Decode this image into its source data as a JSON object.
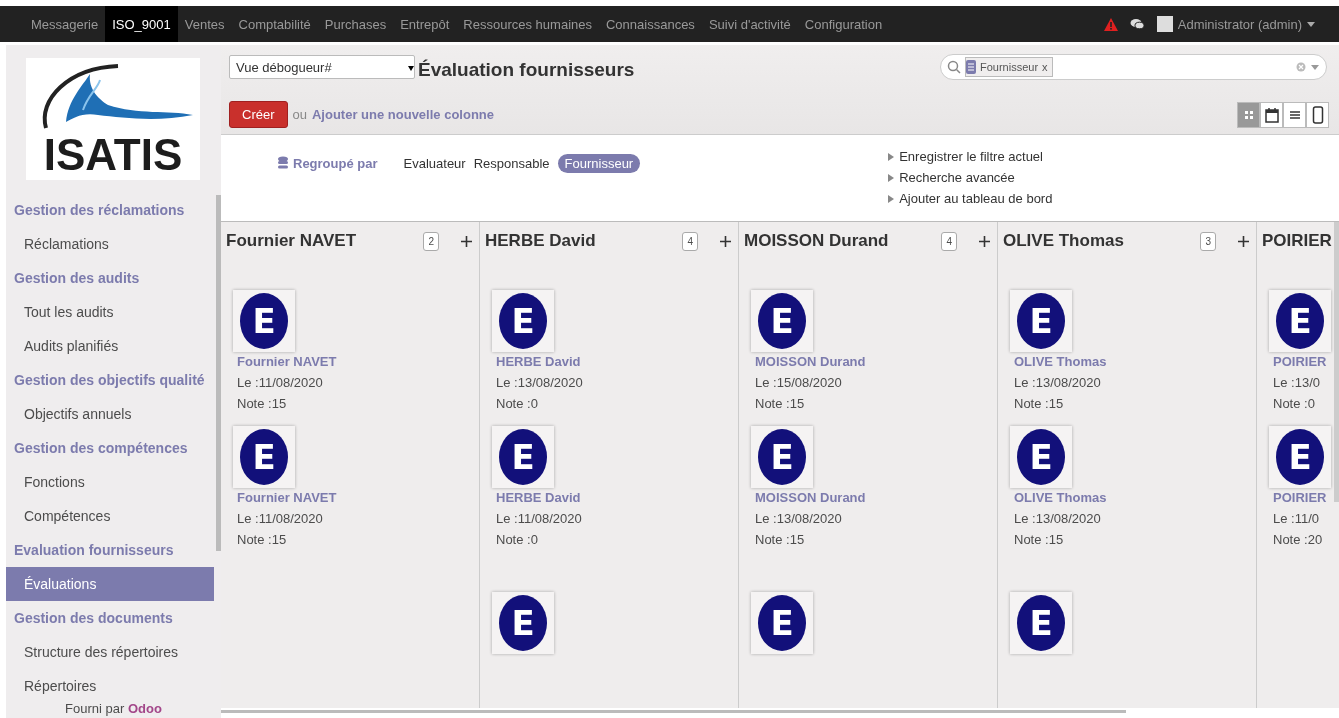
{
  "navbar": {
    "menus": [
      {
        "label": "Messagerie",
        "selected": false
      },
      {
        "label": "ISO_9001",
        "selected": true
      },
      {
        "label": "Ventes",
        "selected": false
      },
      {
        "label": "Comptabilité",
        "selected": false
      },
      {
        "label": "Purchases",
        "selected": false
      },
      {
        "label": "Entrepôt",
        "selected": false
      },
      {
        "label": "Ressources humaines",
        "selected": false
      },
      {
        "label": "Connaissances",
        "selected": false
      },
      {
        "label": "Suivi d'activité",
        "selected": false
      },
      {
        "label": "Configuration",
        "selected": false
      }
    ],
    "user": "Administrator (admin)"
  },
  "sidebar": {
    "logo_text": "ISATIS",
    "sections": [
      {
        "title": "Gestion des réclamations",
        "items": [
          {
            "label": "Réclamations",
            "selected": false
          }
        ]
      },
      {
        "title": "Gestion des audits",
        "items": [
          {
            "label": "Tout les audits",
            "selected": false
          },
          {
            "label": "Audits planifiés",
            "selected": false
          }
        ]
      },
      {
        "title": "Gestion des objectifs qualité",
        "items": [
          {
            "label": "Objectifs annuels",
            "selected": false
          }
        ]
      },
      {
        "title": "Gestion des compétences",
        "items": [
          {
            "label": "Fonctions",
            "selected": false
          },
          {
            "label": "Compétences",
            "selected": false
          }
        ]
      },
      {
        "title": "Evaluation fournisseurs",
        "items": [
          {
            "label": "Évaluations",
            "selected": true
          }
        ]
      },
      {
        "title": "Gestion des documents",
        "items": [
          {
            "label": "Structure des répertoires",
            "selected": false
          },
          {
            "label": "Répertoires",
            "selected": false
          }
        ]
      }
    ],
    "footer_text": "Fourni par",
    "footer_link": "Odoo"
  },
  "header": {
    "debug_select": "Vue débogueur#",
    "title": "Évaluation fournisseurs",
    "search_facet": "Fournisseur",
    "facet_remove": "x",
    "create_button": "Créer",
    "or_text": "ou",
    "add_column_link": "Ajouter une nouvelle colonne",
    "views": [
      {
        "kind": "kanban",
        "selected": true
      },
      {
        "kind": "calendar",
        "selected": false
      },
      {
        "kind": "list",
        "selected": false
      },
      {
        "kind": "form",
        "selected": false
      }
    ]
  },
  "search_panel": {
    "group_by_label": "Regroupé par",
    "group_by_options": [
      {
        "label": "Evaluateur",
        "selected": false
      },
      {
        "label": "Responsable",
        "selected": false
      },
      {
        "label": "Fournisseur",
        "selected": true
      }
    ],
    "actions": [
      "Enregistrer le filtre actuel",
      "Recherche avancée",
      "Ajouter au tableau de bord"
    ]
  },
  "kanban": {
    "columns": [
      {
        "title": "Fournier NAVET",
        "count": "2",
        "cards": [
          {
            "avatar": "E",
            "name": "Fournier NAVET",
            "date": "Le :11/08/2020",
            "note": "Note :15"
          },
          {
            "avatar": "E",
            "name": "Fournier NAVET",
            "date": "Le :11/08/2020",
            "note": "Note :15"
          }
        ]
      },
      {
        "title": "HERBE David",
        "count": "4",
        "cards": [
          {
            "avatar": "E",
            "name": "HERBE David",
            "date": "Le :13/08/2020",
            "note": "Note :0"
          },
          {
            "avatar": "E",
            "name": "HERBE David",
            "date": "Le :11/08/2020",
            "note": "Note :0"
          },
          {
            "avatar": "E"
          }
        ]
      },
      {
        "title": "MOISSON Durand",
        "count": "4",
        "cards": [
          {
            "avatar": "E",
            "name": "MOISSON Durand",
            "date": "Le :15/08/2020",
            "note": "Note :15"
          },
          {
            "avatar": "E",
            "name": "MOISSON Durand",
            "date": "Le :13/08/2020",
            "note": "Note :15"
          },
          {
            "avatar": "E"
          }
        ]
      },
      {
        "title": "OLIVE Thomas",
        "count": "3",
        "cards": [
          {
            "avatar": "E",
            "name": "OLIVE Thomas",
            "date": "Le :13/08/2020",
            "note": "Note :15"
          },
          {
            "avatar": "E",
            "name": "OLIVE Thomas",
            "date": "Le :13/08/2020",
            "note": "Note :15"
          },
          {
            "avatar": "E"
          }
        ]
      },
      {
        "title": "POIRIER",
        "cards": [
          {
            "avatar": "E",
            "name": "POIRIER",
            "date": "Le :13/0",
            "note": "Note :0"
          },
          {
            "avatar": "E",
            "name": "POIRIER",
            "date": "Le :11/0",
            "note": "Note :20"
          }
        ]
      }
    ]
  }
}
